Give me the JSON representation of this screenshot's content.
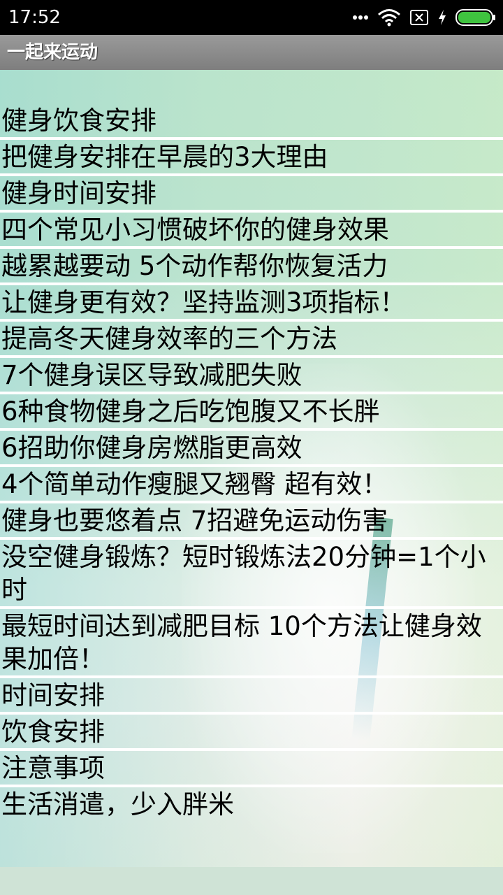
{
  "status_bar": {
    "time": "17:52",
    "icons": [
      "more-dots-icon",
      "wifi-icon",
      "no-sim-icon",
      "charging-icon",
      "battery-icon"
    ],
    "battery_color": "#3fc33f"
  },
  "app_bar": {
    "title": "一起来运动"
  },
  "list": {
    "items": [
      "健身饮食安排",
      "把健身安排在早晨的3大理由",
      "健身时间安排",
      "四个常见小习惯破坏你的健身效果",
      "越累越要动 5个动作帮你恢复活力",
      "让健身更有效？坚持监测3项指标！",
      "提高冬天健身效率的三个方法",
      "7个健身误区导致减肥失败",
      "6种食物健身之后吃饱腹又不长胖",
      "6招助你健身房燃脂更高效",
      "4个简单动作瘦腿又翘臀 超有效！",
      "健身也要悠着点 7招避免运动伤害",
      "没空健身锻炼？短时锻炼法20分钟=1个小时",
      "最短时间达到减肥目标 10个方法让健身效果加倍！",
      "时间安排",
      "饮食安排",
      "注意事项",
      "生活消遣，少入胖米"
    ]
  }
}
